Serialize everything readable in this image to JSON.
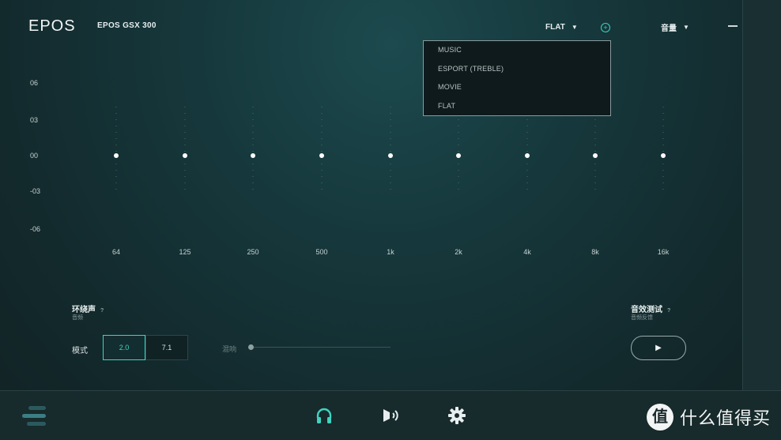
{
  "header": {
    "logo": "EPOS",
    "device": "EPOS GSX 300",
    "preset": "FLAT",
    "volume": "音量"
  },
  "dropdown": {
    "options": [
      "MUSIC",
      "ESPORT (TREBLE)",
      "MOVIE",
      "FLAT"
    ]
  },
  "eq": {
    "y_ticks": [
      "06",
      "03",
      "00",
      "-03",
      "-06"
    ],
    "x_ticks": [
      "64",
      "125",
      "250",
      "500",
      "1k",
      "2k",
      "4k",
      "8k",
      "16k"
    ]
  },
  "chart_data": {
    "type": "line",
    "x": [
      "64",
      "125",
      "250",
      "500",
      "1k",
      "2k",
      "4k",
      "8k",
      "16k"
    ],
    "series": [
      {
        "values": [
          0,
          0,
          0,
          0,
          0,
          0,
          0,
          0,
          0
        ]
      }
    ],
    "ylim": [
      -6,
      6
    ],
    "grid": false
  },
  "surround": {
    "title": "环绕声",
    "subtitle": "音频",
    "help": "?",
    "mode_label": "模式",
    "mode_options": [
      "2.0",
      "7.1"
    ],
    "reverb_label": "混响"
  },
  "sound_test": {
    "title": "音效测试",
    "subtitle": "音频反馈",
    "help": "?"
  },
  "watermark": {
    "circle": "值",
    "text": "什么值得买"
  },
  "colors": {
    "accent": "#3fd3c0",
    "background": "#16383c"
  },
  "icons": [
    "menu-icon",
    "headphones-icon",
    "speaker-waves-icon",
    "gear-icon",
    "play-icon",
    "plus-icon",
    "chevron-down-icon",
    "minimize-icon"
  ]
}
